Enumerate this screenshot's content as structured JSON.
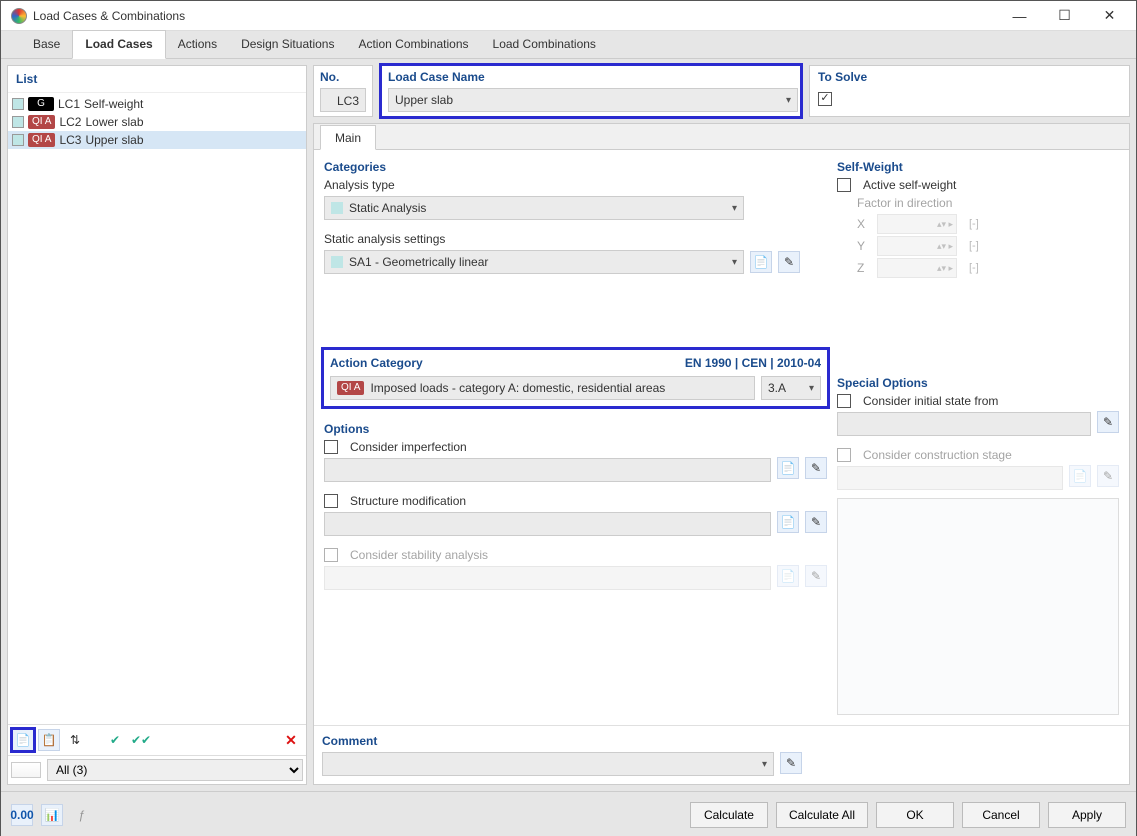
{
  "window": {
    "title": "Load Cases & Combinations"
  },
  "tabs": [
    "Base",
    "Load Cases",
    "Actions",
    "Design Situations",
    "Action Combinations",
    "Load Combinations"
  ],
  "active_tab_index": 1,
  "list": {
    "header": "List",
    "items": [
      {
        "swatch": "#bfe6e6",
        "tag": "G",
        "tag_kind": "g",
        "code": "LC1",
        "name": "Self-weight"
      },
      {
        "swatch": "#bfe6e6",
        "tag": "QI A",
        "tag_kind": "q",
        "code": "LC2",
        "name": "Lower slab"
      },
      {
        "swatch": "#bfe6e6",
        "tag": "QI A",
        "tag_kind": "q",
        "code": "LC3",
        "name": "Upper slab"
      }
    ],
    "selected_index": 2,
    "filter": "All (3)"
  },
  "header": {
    "no_label": "No.",
    "no_value": "LC3",
    "name_label": "Load Case Name",
    "name_value": "Upper slab",
    "to_solve_label": "To Solve",
    "to_solve_checked": true
  },
  "main_tab": "Main",
  "categories": {
    "title": "Categories",
    "analysis_type_label": "Analysis type",
    "analysis_type_value": "Static Analysis",
    "settings_label": "Static analysis settings",
    "settings_value": "SA1 - Geometrically linear"
  },
  "action_category": {
    "title": "Action Category",
    "standard_ref": "EN 1990 | CEN | 2010-04",
    "tag": "QI A",
    "description": "Imposed loads - category A: domestic, residential areas",
    "code": "3.A"
  },
  "options": {
    "title": "Options",
    "consider_imperfection": "Consider imperfection",
    "structure_modification": "Structure modification",
    "consider_stability": "Consider stability analysis"
  },
  "self_weight": {
    "title": "Self-Weight",
    "active_label": "Active self-weight",
    "factor_label": "Factor in direction",
    "axes": [
      "X",
      "Y",
      "Z"
    ],
    "unit": "[-]"
  },
  "special": {
    "title": "Special Options",
    "initial_state": "Consider initial state from",
    "construction_stage": "Consider construction stage"
  },
  "comment": {
    "title": "Comment"
  },
  "footer": {
    "calculate": "Calculate",
    "calculate_all": "Calculate All",
    "ok": "OK",
    "cancel": "Cancel",
    "apply": "Apply"
  }
}
